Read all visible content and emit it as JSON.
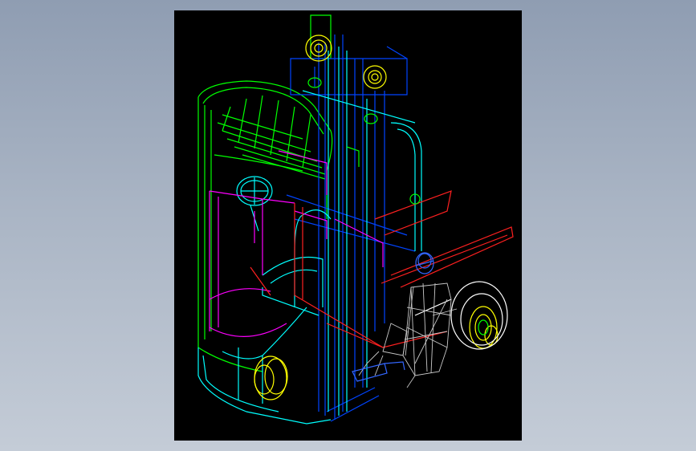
{
  "viewport": {
    "background": "#000000",
    "page_background": "#9aa6b8"
  },
  "model": {
    "subject": "forklift-wireframe-drawing",
    "line_colors": {
      "frame": "#00ff00",
      "mast": "#0044ff",
      "mast_inner": "#00ffff",
      "forks": "#ff2020",
      "seat_panel": "#ff00ff",
      "wheels": "#ffff00",
      "operator": "#c0c0c0",
      "operator_head": "#3366ff",
      "operator_outline": "#ffffff"
    }
  }
}
